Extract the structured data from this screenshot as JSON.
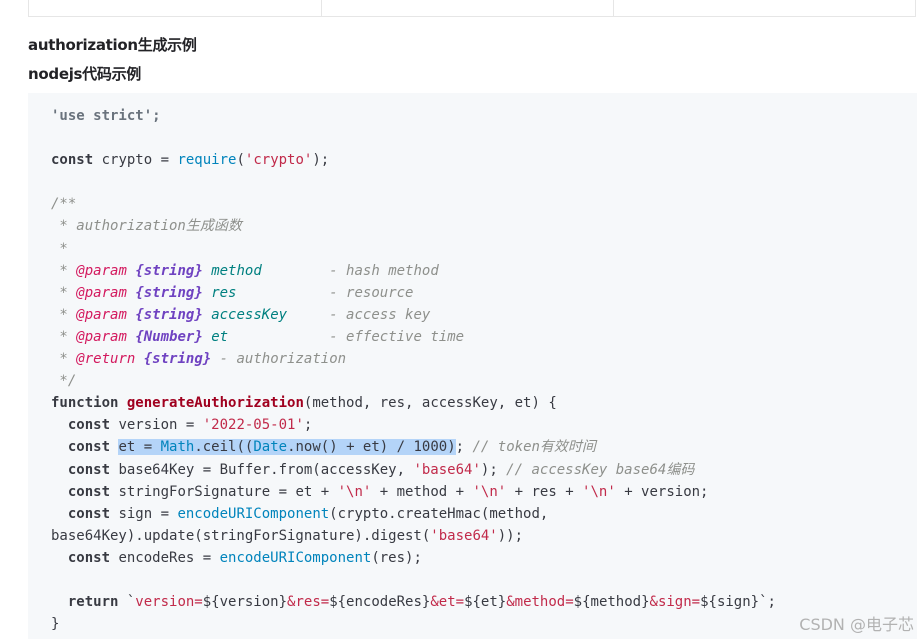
{
  "headings": {
    "h1": "authorization生成示例",
    "h2": "nodejs代码示例"
  },
  "code": {
    "l1": "'use strict';",
    "l3_kw": "const",
    "l3_a": " crypto = ",
    "l3_fn": "require",
    "l3_b": "(",
    "l3_str": "'crypto'",
    "l3_c": ");",
    "c1": "/**",
    "c2": " * authorization生成函数",
    "c3": " *",
    "c4_pre": " * ",
    "c4_tag": "@param",
    "c4_type": "{string}",
    "c4_var": "method",
    "c4_desc": "        - hash method",
    "c5_pre": " * ",
    "c5_tag": "@param",
    "c5_type": "{string}",
    "c5_var": "res",
    "c5_desc": "           - resource",
    "c6_pre": " * ",
    "c6_tag": "@param",
    "c6_type": "{string}",
    "c6_var": "accessKey",
    "c6_desc": "     - access key",
    "c7_pre": " * ",
    "c7_tag": "@param",
    "c7_type": "{Number}",
    "c7_var": "et",
    "c7_desc": "            - effective time",
    "c8_pre": " * ",
    "c8_tag": "@return",
    "c8_type": "{string}",
    "c8_desc": " - authorization",
    "c9": " */",
    "f_kw": "function",
    "f_name": "generateAuthorization",
    "f_args": "(method, res, accessKey, et) {",
    "v_kw": "const",
    "v_a": " version = ",
    "v_str": "'2022-05-01'",
    "v_b": ";",
    "e_kw": "const",
    "e_sel_a": "et = ",
    "e_math": "Math",
    "e_sel_b": ".ceil((",
    "e_date": "Date",
    "e_sel_c": ".now() + et) / 1000)",
    "e_semi": ";",
    "e_cm": " // token有效时间",
    "b_kw": "const",
    "b_a": " base64Key = Buffer.from(accessKey, ",
    "b_str": "'base64'",
    "b_b": ");",
    "b_cm": " // accessKey base64编码",
    "s_kw": "const",
    "s_a": " stringForSignature = et + ",
    "s_s1": "'\\n'",
    "s_b": " + method + ",
    "s_s2": "'\\n'",
    "s_c": " + res + ",
    "s_s3": "'\\n'",
    "s_d": " + version;",
    "g_kw": "const",
    "g_a": " sign = ",
    "g_fn": "encodeURIComponent",
    "g_b": "(crypto.createHmac(method,",
    "g2_a": "base64Key).update(stringForSignature).digest(",
    "g2_str": "'base64'",
    "g2_b": "));",
    "r_kw": "const",
    "r_a": " encodeRes = ",
    "r_fn": "encodeURIComponent",
    "r_b": "(res);",
    "ret_kw": "return",
    "ret_a": " `",
    "ret_s1": "version=",
    "ret_i1": "${version}",
    "ret_s2": "&res=",
    "ret_i2": "${encodeRes}",
    "ret_s3": "&et=",
    "ret_i3": "${et}",
    "ret_s4": "&method=",
    "ret_i4": "${method}",
    "ret_s5": "&sign=",
    "ret_i5": "${sign}",
    "ret_b": "`;",
    "close": "}"
  },
  "watermark": "CSDN @电子芯"
}
